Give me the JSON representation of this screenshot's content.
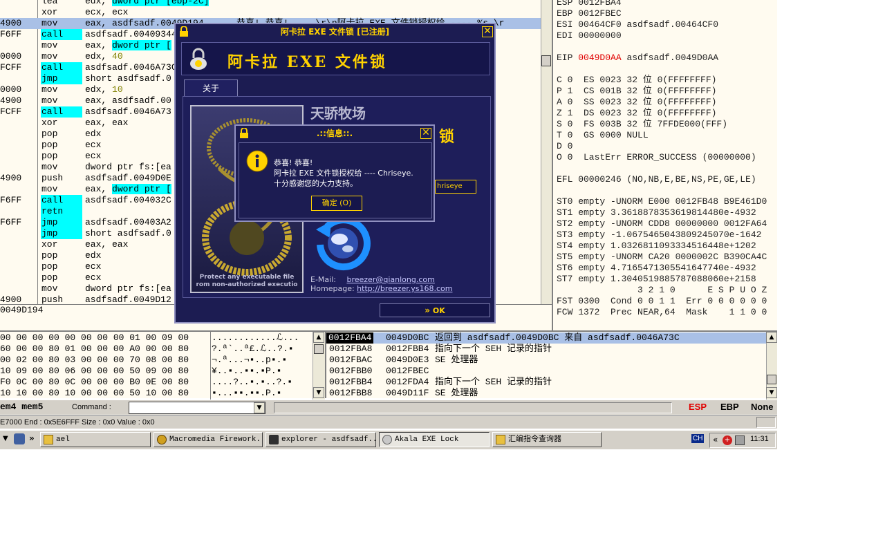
{
  "disasm": {
    "rows": [
      {
        "addr": "",
        "mn": "lea",
        "op": "edx, dword ptr [ebp-2C]",
        "hl": false
      },
      {
        "addr": "",
        "mn": "xor",
        "op": "ecx, ecx",
        "hl": false
      },
      {
        "addr": "4900",
        "mn": "mov",
        "op": "eax, asdfsadf.0049D194",
        "hl": false,
        "comment": "恭喜! 恭喜! ... \\r\\n阿卡拉 EXE 文件锁授权给 ---- %s.\\r",
        "sel": true
      },
      {
        "addr": "F6FF",
        "mn": "call",
        "op": "asdfsadf.00409344",
        "hl": true
      },
      {
        "addr": "",
        "mn": "mov",
        "op": "eax, dword ptr [",
        "hl": false
      },
      {
        "addr": "0000",
        "mn": "mov",
        "op": "edx, 40",
        "hl": false
      },
      {
        "addr": "FCFF",
        "mn": "call",
        "op": "asdfsadf.0046A73C",
        "hl": true
      },
      {
        "addr": "",
        "mn": "jmp",
        "op": "short asdfsadf.0",
        "hl": true
      },
      {
        "addr": "0000",
        "mn": "mov",
        "op": "edx, 10",
        "hl": false
      },
      {
        "addr": "4900",
        "mn": "mov",
        "op": "eax, asdfsadf.00",
        "hl": false
      },
      {
        "addr": "FCFF",
        "mn": "call",
        "op": "asdfsadf.0046A73",
        "hl": true
      },
      {
        "addr": "",
        "mn": "xor",
        "op": "eax, eax",
        "hl": false
      },
      {
        "addr": "",
        "mn": "pop",
        "op": "edx",
        "hl": false
      },
      {
        "addr": "",
        "mn": "pop",
        "op": "ecx",
        "hl": false
      },
      {
        "addr": "",
        "mn": "pop",
        "op": "ecx",
        "hl": false
      },
      {
        "addr": "",
        "mn": "mov",
        "op": "dword ptr fs:[ea",
        "hl": false
      },
      {
        "addr": "4900",
        "mn": "push",
        "op": "asdfsadf.0049D0E",
        "hl": false
      },
      {
        "addr": "",
        "mn": "mov",
        "op": "eax, dword ptr [",
        "hl": false
      },
      {
        "addr": "F6FF",
        "mn": "call",
        "op": "asdfsadf.004032C",
        "hl": true
      },
      {
        "addr": "",
        "mn": "retn",
        "op": "",
        "hl": true
      },
      {
        "addr": "F6FF",
        "mn": "jmp",
        "op": "asdfsadf.00403A2",
        "hl": true
      },
      {
        "addr": "",
        "mn": "jmp",
        "op": "short asdfsadf.0",
        "hl": true
      },
      {
        "addr": "",
        "mn": "xor",
        "op": "eax, eax",
        "hl": false
      },
      {
        "addr": "",
        "mn": "pop",
        "op": "edx",
        "hl": false
      },
      {
        "addr": "",
        "mn": "pop",
        "op": "ecx",
        "hl": false
      },
      {
        "addr": "",
        "mn": "pop",
        "op": "ecx",
        "hl": false
      },
      {
        "addr": "",
        "mn": "mov",
        "op": "dword ptr fs:[ea",
        "hl": false
      },
      {
        "addr": "4900",
        "mn": "push",
        "op": "asdfsadf.0049D12",
        "hl": false
      }
    ],
    "info_line": "0049D194"
  },
  "registers": {
    "lines": [
      "ESP 0012FBA4",
      "EBP 0012FBEC",
      "ESI 00464CF0 asdfsadf.00464CF0",
      "EDI 00000000",
      "",
      "EIP |0049D0AA| asdfsadf.0049D0AA",
      "",
      "C 0  ES 0023 32 位 0(FFFFFFFF)",
      "P 1  CS 001B 32 位 0(FFFFFFFF)",
      "A 0  SS 0023 32 位 0(FFFFFFFF)",
      "Z 1  DS 0023 32 位 0(FFFFFFFF)",
      "S 0  FS 003B 32 位 7FFDE000(FFF)",
      "T 0  GS 0000 NULL",
      "D 0",
      "O 0  LastErr ERROR_SUCCESS (00000000)",
      "",
      "EFL 00000246 (NO,NB,E,BE,NS,PE,GE,LE)",
      "",
      "ST0 empty -UNORM E000 0012FB48 B9E461D0",
      "ST1 empty 3.3618878353619814480e-4932",
      "ST2 empty -UNORM CDD8 00000000 0012FA64",
      "ST3 empty -1.0675465043809245070e-1642",
      "ST4 empty 1.0326811093334516448e+1202",
      "ST5 empty -UNORM CA20 0000002C B390CA4C",
      "ST6 empty 4.7165471305541647740e-4932",
      "ST7 empty 1.3040519885787088060e+2158",
      "               3 2 1 0      E S P U O Z",
      "FST 0300  Cond 0 0 1 1  Err 0 0 0 0 0 0",
      "FCW 1372  Prec NEAR,64  Mask    1 1 0 0"
    ]
  },
  "dump": {
    "rows": [
      {
        "hex": "00 00 00 00 00 00 00 00 01 00 09 00",
        "asc": "............ℒ..."
      },
      {
        "hex": "60 00 00 80 01 00 00 00 A0 00 00 80",
        "asc": "?.ª`..ª£.ℒ..?.▪"
      },
      {
        "hex": "00 02 00 80 03 00 00 00 70 08 00 80",
        "asc": "¬.ª...¬▪..p▪.▪"
      },
      {
        "hex": "10 09 00 80 06 00 00 00 50 09 00 80",
        "asc": "¥..▪..▪▪.▪P.▪"
      },
      {
        "hex": "F0 0C 00 80 0C 00 00 00 B0 0E 00 80",
        "asc": "....?..▪.▪..?.▪"
      },
      {
        "hex": "10 10 00 80 10 00 00 00 50 10 00 80",
        "asc": "▪...▪▪.▪▪.P.▪"
      }
    ]
  },
  "stack": {
    "rows": [
      {
        "addr": "0012FBA4",
        "val": "0049D0BC",
        "comment": "返回到 asdfsadf.0049D0BC 来自 asdfsadf.0046A73C",
        "sel": true
      },
      {
        "addr": "0012FBA8",
        "val": "0012FBB4",
        "comment": "指向下一个 SEH 记录的指针"
      },
      {
        "addr": "0012FBAC",
        "val": "0049D0E3",
        "comment": "SE 处理器"
      },
      {
        "addr": "0012FBB0",
        "val": "0012FBEC",
        "comment": ""
      },
      {
        "addr": "0012FBB4",
        "val": "0012FDA4",
        "comment": "指向下一个 SEH 记录的指针"
      },
      {
        "addr": "0012FBB8",
        "val": "0049D11F",
        "comment": "SE 处理器"
      }
    ]
  },
  "cmdbar": {
    "left": "em4 mem5",
    "command_label": "Command :",
    "command_value": "",
    "esp": "ESP",
    "ebp": "EBP",
    "none": "None"
  },
  "statusbar": {
    "text": "E7000 End : 0x5E6FFF Size : 0x0 Value : 0x0"
  },
  "taskbar": {
    "tasks": [
      "ael",
      "Macromedia Firework...",
      "explorer - asdfsadf...",
      "Akala EXE Lock",
      "汇编指令查询器"
    ],
    "lang": "CH",
    "time": "11:31"
  },
  "mainwin": {
    "title": "阿卡拉 EXE 文件锁 [已注册]",
    "header_title": "阿卡拉 EXE 文件锁",
    "tab_label": "关于",
    "company": "天骄牧场",
    "side_title_fragment": "锁",
    "user_fragment": "hriseye",
    "banner_caption_1": "Protect any executable file",
    "banner_caption_2": "rom non-authorized executio",
    "email_label": "E-Mail:",
    "email": "breezer@qianlong.com",
    "homepage_label": "Homepage:",
    "homepage": "http://breezer.ys168.com",
    "ok_label": "OK"
  },
  "infowin": {
    "title": ".::信息::.",
    "line1": "恭喜! 恭喜!",
    "line2": "阿卡拉 EXE 文件锁授权给 ---- Chriseye.",
    "line3": "十分感谢您的大力支持。",
    "ok_label": "确定 (O)"
  },
  "colors": {
    "accent_gold": "#ffd200",
    "dialog_bg": "#1c1c52",
    "highlight_cyan": "#00ffff",
    "selection": "#a9c0e6",
    "red": "#e00000"
  }
}
